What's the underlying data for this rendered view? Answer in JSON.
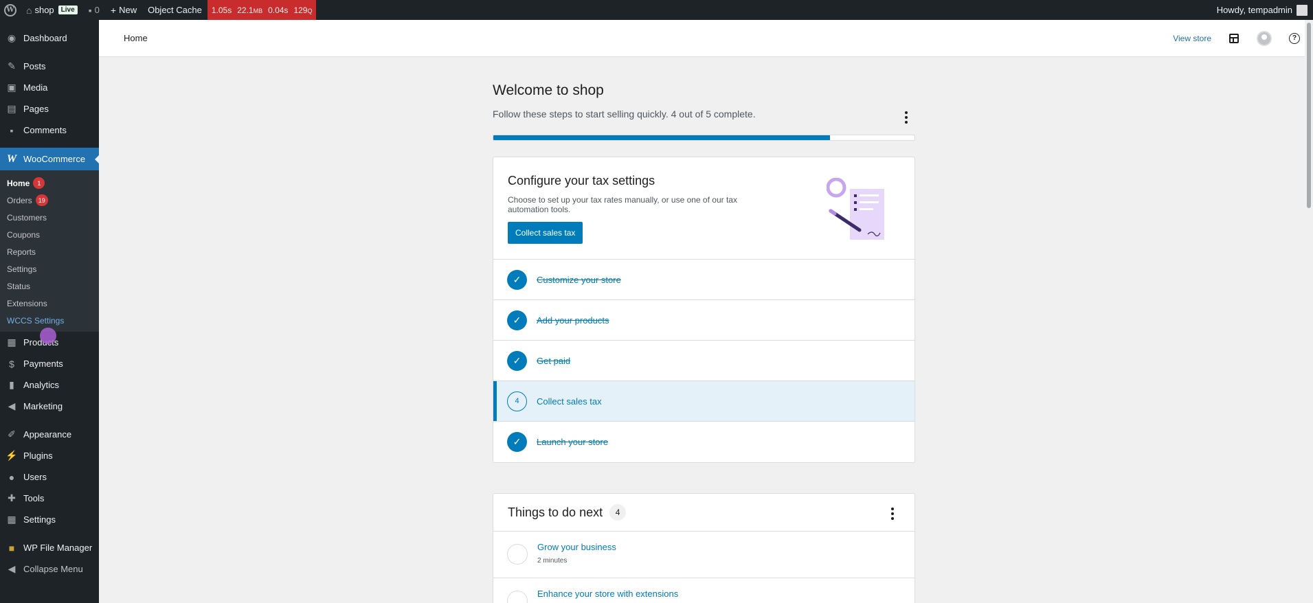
{
  "admin_bar": {
    "site_name": "shop",
    "live_badge": "Live",
    "comments_count": "0",
    "new_label": "New",
    "object_cache": "Object Cache",
    "qm": {
      "time": "1.05s",
      "memory": "22.1",
      "memory_unit": "MB",
      "db_time": "0.04s",
      "queries": "129",
      "queries_unit": "Q"
    },
    "howdy": "Howdy, tempadmin"
  },
  "sidebar": {
    "items_top": [
      {
        "label": "Dashboard",
        "icon": "dashboard-icon"
      },
      {
        "label": "Posts",
        "icon": "pin-icon"
      },
      {
        "label": "Media",
        "icon": "media-icon"
      },
      {
        "label": "Pages",
        "icon": "pages-icon"
      },
      {
        "label": "Comments",
        "icon": "comments-icon"
      }
    ],
    "woocommerce": {
      "label": "WooCommerce",
      "icon_glyph": "W"
    },
    "submenu": [
      {
        "label": "Home",
        "count": "1"
      },
      {
        "label": "Orders",
        "count": "19"
      },
      {
        "label": "Customers"
      },
      {
        "label": "Coupons"
      },
      {
        "label": "Reports"
      },
      {
        "label": "Settings"
      },
      {
        "label": "Status"
      },
      {
        "label": "Extensions"
      },
      {
        "label": "WCCS Settings"
      }
    ],
    "items_bottom": [
      {
        "label": "Products",
        "icon": "products-icon"
      },
      {
        "label": "Payments",
        "icon": "payments-icon"
      },
      {
        "label": "Analytics",
        "icon": "analytics-icon"
      },
      {
        "label": "Marketing",
        "icon": "megaphone-icon"
      },
      {
        "label": "Appearance",
        "icon": "brush-icon"
      },
      {
        "label": "Plugins",
        "icon": "plugin-icon"
      },
      {
        "label": "Users",
        "icon": "users-icon"
      },
      {
        "label": "Tools",
        "icon": "wrench-icon"
      },
      {
        "label": "Settings",
        "icon": "settings-icon"
      },
      {
        "label": "WP File Manager",
        "icon": "folder-icon"
      },
      {
        "label": "Collapse Menu",
        "icon": "collapse-icon"
      }
    ]
  },
  "header": {
    "title": "Home",
    "view_store": "View store"
  },
  "welcome": {
    "title": "Welcome to shop",
    "subtitle": "Follow these steps to start selling quickly. 4 out of 5 complete.",
    "progress_fraction": 0.8
  },
  "task_hero": {
    "title": "Configure your tax settings",
    "description": "Choose to set up your tax rates manually, or use one of our tax automation tools.",
    "button": "Collect sales tax"
  },
  "tasks": [
    {
      "label": "Customize your store",
      "done": true
    },
    {
      "label": "Add your products",
      "done": true
    },
    {
      "label": "Get paid",
      "done": true
    },
    {
      "label": "Collect sales tax",
      "done": false,
      "number": "4"
    },
    {
      "label": "Launch your store",
      "done": true
    }
  ],
  "todo": {
    "title": "Things to do next",
    "count": "4",
    "items": [
      {
        "title": "Grow your business",
        "time": "2 minutes"
      },
      {
        "title": "Enhance your store with extensions",
        "time": ""
      }
    ]
  },
  "colors": {
    "accent": "#007cba",
    "admin_bg": "#1d2327",
    "woo_active": "#2271b1",
    "qm_red": "#c92c2c",
    "badge_red": "#d63638"
  }
}
